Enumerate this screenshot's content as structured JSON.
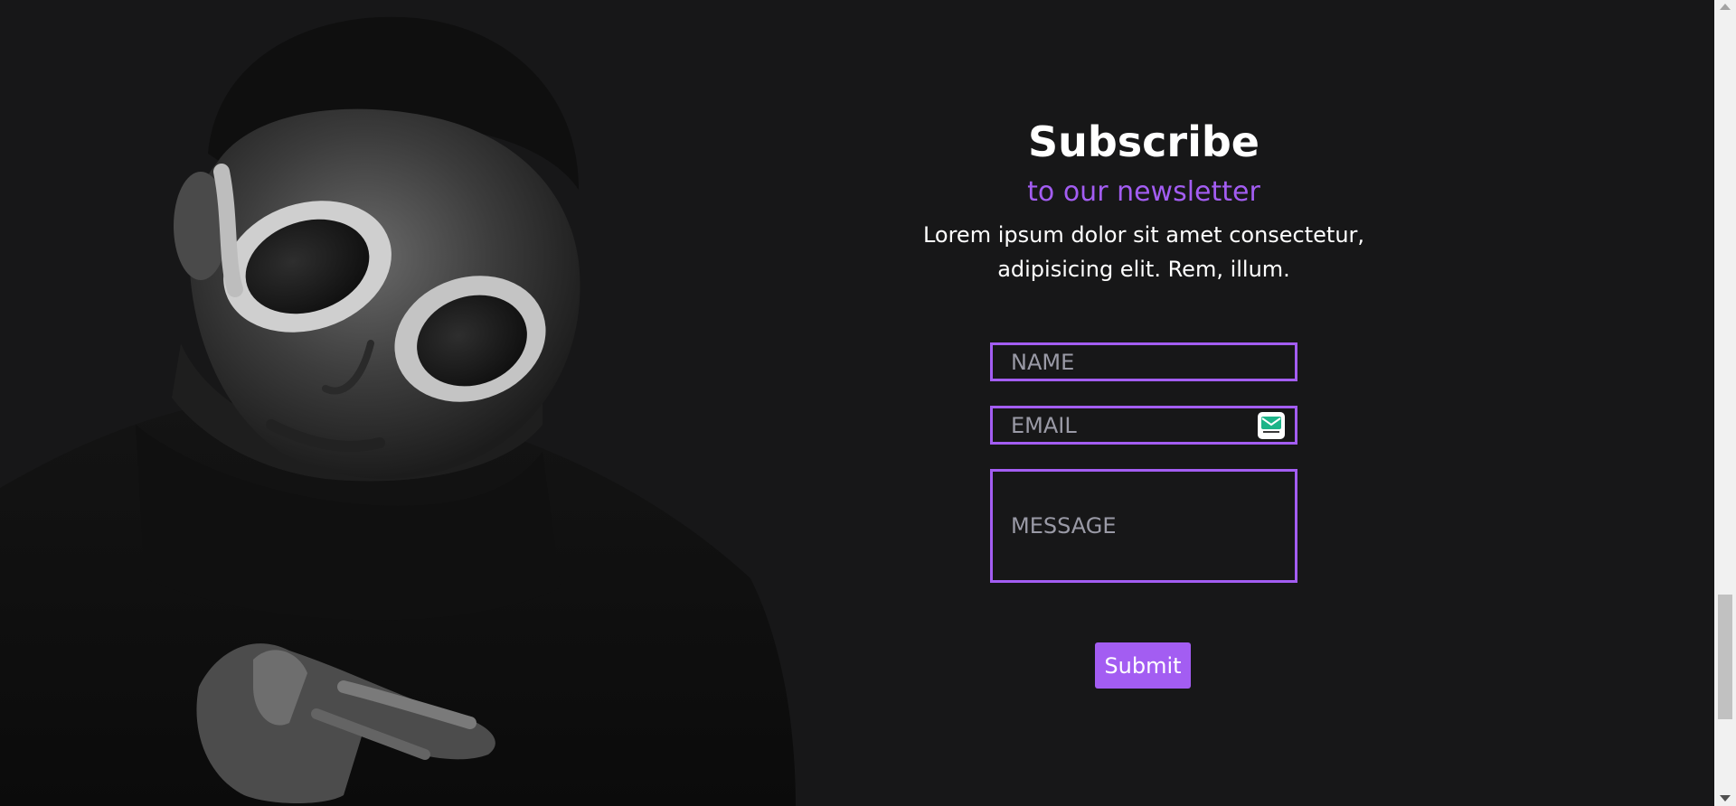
{
  "newsletter": {
    "title": "Subscribe",
    "subtitle": "to our newsletter",
    "description_line1": "Lorem ipsum dolor sit amet consectetur,",
    "description_line2": "adipisicing elit. Rem, illum.",
    "name_placeholder": "NAME",
    "email_placeholder": "EMAIL",
    "message_placeholder": "MESSAGE",
    "submit_label": "Submit"
  },
  "icons": {
    "email_addon": "email-extension-icon"
  },
  "colors": {
    "background": "#171718",
    "accent": "#a35df2",
    "text": "#ffffff",
    "placeholder": "#9a9aa6"
  }
}
